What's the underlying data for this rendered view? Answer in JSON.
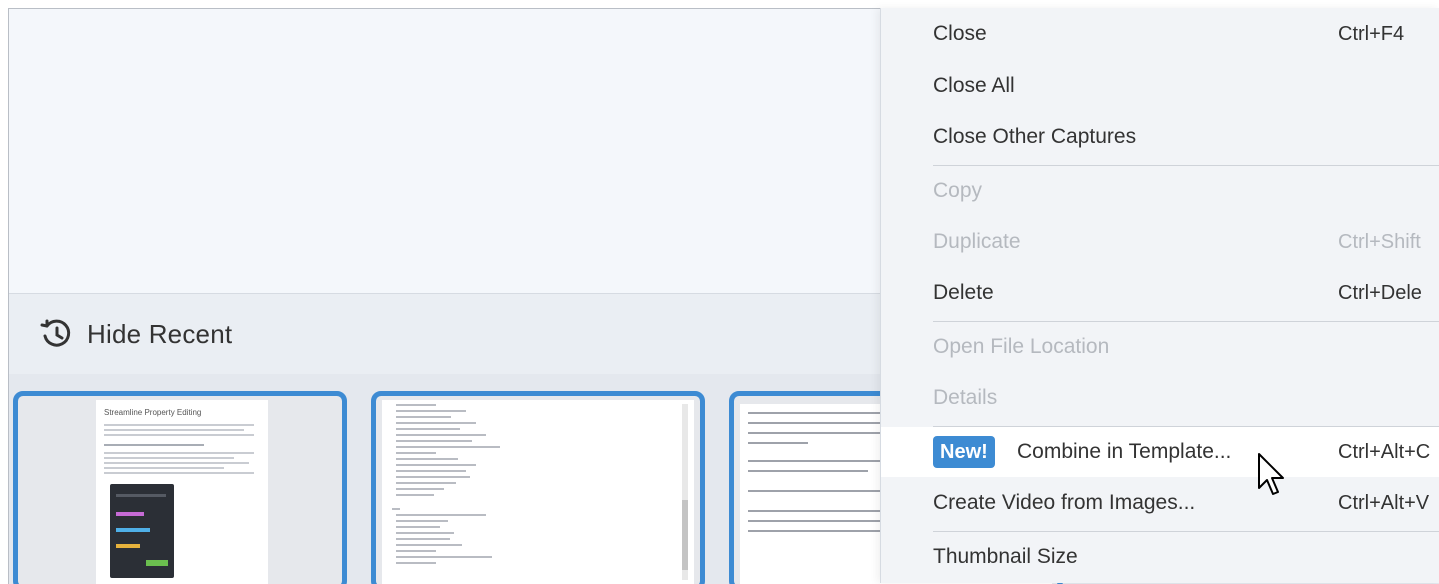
{
  "recent": {
    "toggle_label": "Hide Recent",
    "toggle_icon": "history-icon"
  },
  "thumbnails": [
    {
      "title": "Streamline Property Editing",
      "kind": "document"
    },
    {
      "kind": "code"
    },
    {
      "kind": "article"
    }
  ],
  "context_menu": {
    "close": {
      "label": "Close",
      "shortcut": "Ctrl+F4"
    },
    "close_all": {
      "label": "Close All"
    },
    "close_other": {
      "label": "Close Other Captures"
    },
    "copy": {
      "label": "Copy"
    },
    "duplicate": {
      "label": "Duplicate",
      "shortcut": "Ctrl+Shift"
    },
    "delete": {
      "label": "Delete",
      "shortcut": "Ctrl+Dele"
    },
    "open_location": {
      "label": "Open File Location"
    },
    "details": {
      "label": "Details"
    },
    "combine": {
      "badge": "New!",
      "label": "Combine in Template...",
      "shortcut": "Ctrl+Alt+C"
    },
    "create_video": {
      "label": "Create Video from Images...",
      "shortcut": "Ctrl+Alt+V"
    },
    "thumbnail_size": {
      "label": "Thumbnail Size"
    }
  },
  "colors": {
    "accent": "#3d8bd3",
    "menu_bg": "#f2f4f7",
    "disabled_text": "#b5b9bf"
  }
}
